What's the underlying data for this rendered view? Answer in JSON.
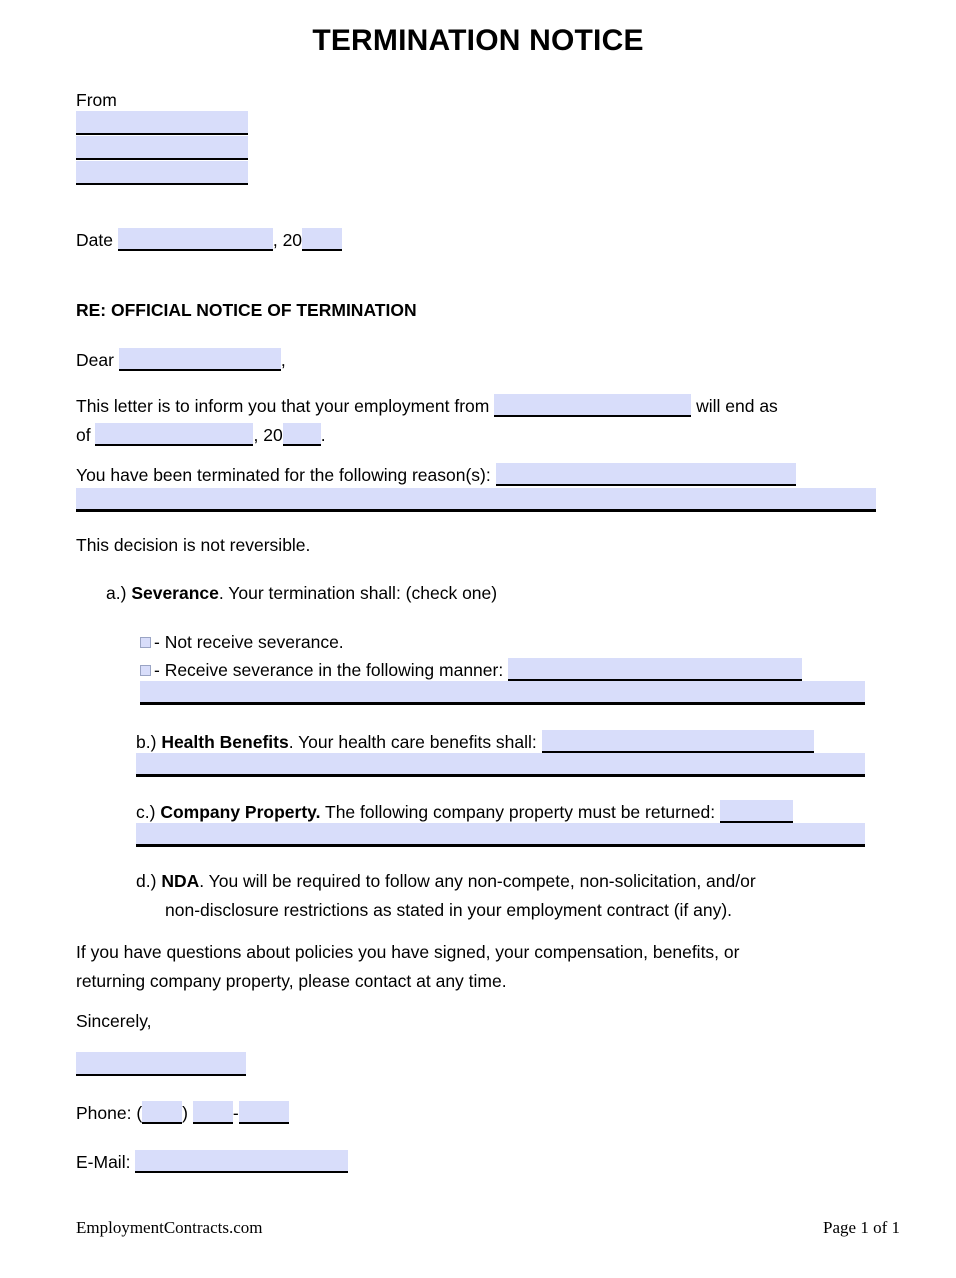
{
  "document": {
    "title": "TERMINATION NOTICE",
    "from_label": "From",
    "date_label": "Date",
    "year_prefix": ", 20",
    "subject_line": "RE: OFFICIAL NOTICE OF TERMINATION",
    "salutation_label": "Dear",
    "salutation_comma": ",",
    "body_intro_1": "This letter is to inform you that your employment from",
    "body_intro_2": "will end as",
    "body_intro_3": "of",
    "body_intro_4": ", 20",
    "body_intro_5": ".",
    "reason_label": "You have been terminated for the following reason(s):",
    "not_reversible": "This decision is not reversible.",
    "closing_paragraph_line1": "If you have questions about policies you have signed, your compensation, benefits, or",
    "closing_paragraph_line2": "returning company property, please contact at any time.",
    "sign_off": "Sincerely,",
    "phone_label": "Phone: (",
    "phone_paren_close": ")",
    "phone_dash": "-",
    "email_label": "E-Mail:"
  },
  "items": {
    "a": {
      "marker": "a.)",
      "term": "Severance",
      "text": ". Your termination shall: (check one)",
      "option_1": "- Not receive severance.",
      "option_2": "- Receive severance in the following manner:"
    },
    "b": {
      "marker": "b.)",
      "term": "Health Benefits",
      "text": ". Your health care benefits shall:"
    },
    "c": {
      "marker": "c.)",
      "term": "Company Property.",
      "text": " The following company property must be returned:"
    },
    "d": {
      "marker": "d.)",
      "term": "NDA",
      "text_line1": ". You will be required to follow any non-compete, non-solicitation, and/or",
      "text_line2": "non-disclosure restrictions as stated in your employment contract (if any)."
    }
  },
  "footer": {
    "site": "EmploymentContracts.com",
    "page": "Page 1 of 1"
  },
  "colors": {
    "field_fill": "#d8ddfa",
    "field_rule": "#000000",
    "checkbox_border": "#9aa4c4",
    "text": "#000000"
  }
}
